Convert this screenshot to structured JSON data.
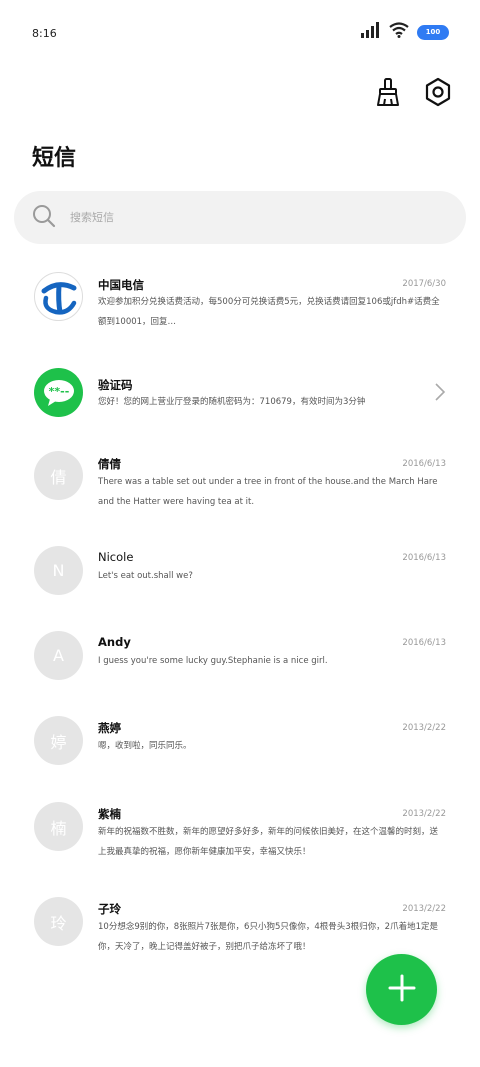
{
  "status_bar": {
    "time": "8:16",
    "battery": "100"
  },
  "header": {
    "title": "短信"
  },
  "search": {
    "placeholder": "搜索短信"
  },
  "messages": [
    {
      "name": "中国电信",
      "date": "2017/6/30",
      "preview": "欢迎参加积分兑换话费活动，每500分可兑换话费5元，兑换话费请回复106或jfdh#话费全额到10001，回复…",
      "avatar": "china-telecom-logo"
    },
    {
      "name": "验证码",
      "date": "",
      "preview": "您好！您的网上营业厅登录的随机密码为：710679，有效时间为3分钟",
      "avatar": "chat-bubble"
    },
    {
      "name": "倩倩",
      "date": "2016/6/13",
      "preview": "There was a table set out under a tree in front of the house.and the March Hare and the Hatter were having tea at it.",
      "avatar_text": "倩"
    },
    {
      "name": "Nicole",
      "date": "2016/6/13",
      "preview": "Let's eat out.shall we?",
      "avatar_text": "N"
    },
    {
      "name": "Andy",
      "date": "2016/6/13",
      "preview": "I guess you're some lucky guy.Stephanie is a nice girl.",
      "avatar_text": "A"
    },
    {
      "name": "燕婷",
      "date": "2013/2/22",
      "preview": "嗯，收到啦，同乐同乐。",
      "avatar_text": "婷"
    },
    {
      "name": "紫楠",
      "date": "2013/2/22",
      "preview": "新年的祝福数不胜数，新年的愿望好多好多，新年的问候依旧美好，在这个温馨的时刻，送上我最真挚的祝福，愿你新年健康加平安，幸福又快乐！",
      "avatar_text": "楠"
    },
    {
      "name": "子玲",
      "date": "2013/2/22",
      "preview": "10分想念9别的你，8张照片7张是你，6只小狗5只像你，4根骨头3根归你，2爪着地1定是你，天冷了，晚上记得盖好被子，别把爪子给冻坏了哦！",
      "avatar_text": "玲"
    }
  ],
  "colors": {
    "accent": "#1ec14a",
    "battery": "#2f7bf3",
    "avatar_bg": "#e5e5e5"
  }
}
